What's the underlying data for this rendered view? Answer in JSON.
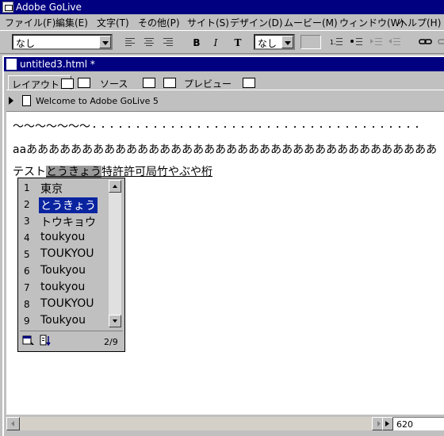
{
  "app": {
    "title": "Adobe GoLive"
  },
  "menu": [
    "ファイル(F)",
    "編集(E)",
    "文字(T)",
    "その他(P)",
    "サイト(S)",
    "デザイン(D)",
    "ムービー(M)",
    "ウィンドウ(W)",
    "ヘルプ(H)"
  ],
  "toolbar": {
    "paragraph_select": "なし",
    "bold": "B",
    "italic": "I",
    "teletype": "T",
    "size_select": "なし"
  },
  "document": {
    "title": "untitled3.html *",
    "tabs": [
      "レイアウト",
      "ソース",
      "プレビュー"
    ],
    "breadcrumb": "Welcome to Adobe GoLive 5",
    "line1_tilde": "〜〜〜〜〜〜〜",
    "line1_dots": "・・・・・・・・・・・・・・・・・・・・・・・・・・・・・・・・・・・・・・",
    "line2": "aaあああああああああああああああああああああああああああああああああああああ",
    "line3_pre": "テスト",
    "line3_sel": "とうきょう",
    "line3_post": "特許許可局竹やぶや桁"
  },
  "ime": {
    "candidates": [
      {
        "n": "1",
        "t": "東京"
      },
      {
        "n": "2",
        "t": "とうきょう"
      },
      {
        "n": "3",
        "t": "トウキョウ"
      },
      {
        "n": "4",
        "t": "toukyou"
      },
      {
        "n": "5",
        "t": "TOUKYOU"
      },
      {
        "n": "6",
        "t": "Toukyou"
      },
      {
        "n": "7",
        "t": "toukyou"
      },
      {
        "n": "8",
        "t": "TOUKYOU"
      },
      {
        "n": "9",
        "t": "Toukyou"
      }
    ],
    "selected_index": 2,
    "page": "2/9"
  },
  "status": {
    "width": "620"
  }
}
